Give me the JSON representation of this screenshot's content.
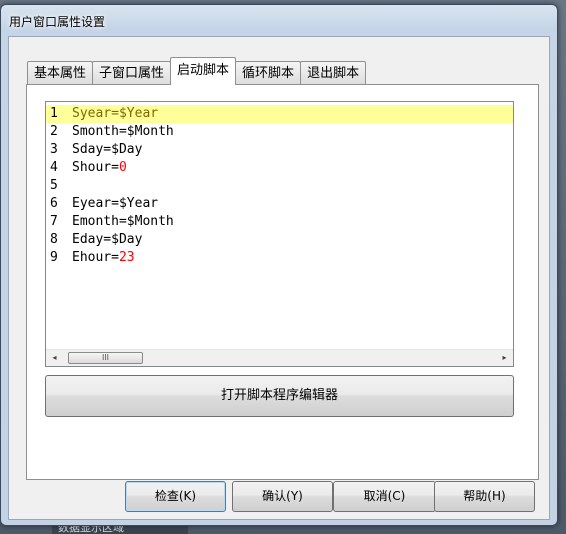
{
  "window": {
    "title": "用户窗口属性设置"
  },
  "tabs": [
    {
      "label": "基本属性",
      "active": false
    },
    {
      "label": "子窗口属性",
      "active": false
    },
    {
      "label": "启动脚本",
      "active": true
    },
    {
      "label": "循环脚本",
      "active": false
    },
    {
      "label": "退出脚本",
      "active": false
    }
  ],
  "editor": {
    "lines": [
      {
        "n": "1",
        "text": "Syear=$Year",
        "num": ""
      },
      {
        "n": "2",
        "text": "Smonth=$Month",
        "num": ""
      },
      {
        "n": "3",
        "text": "Sday=$Day",
        "num": ""
      },
      {
        "n": "4",
        "text": "Shour=",
        "num": "0"
      },
      {
        "n": "5",
        "text": "",
        "num": ""
      },
      {
        "n": "6",
        "text": "Eyear=$Year",
        "num": ""
      },
      {
        "n": "7",
        "text": "Emonth=$Month",
        "num": ""
      },
      {
        "n": "8",
        "text": "Eday=$Day",
        "num": ""
      },
      {
        "n": "9",
        "text": "Ehour=",
        "num": "23"
      }
    ],
    "scroll_left": "◂",
    "scroll_right": "▸",
    "scroll_grip": "III"
  },
  "buttons": {
    "open_editor": "打开脚本程序编辑器",
    "check": "检查(K)",
    "confirm": "确认(Y)",
    "cancel": "取消(C)",
    "help": "帮助(H)"
  },
  "background": {
    "label": "数据显示区域"
  },
  "colors": {
    "highlight": "#ffff99",
    "number": "#ff0000",
    "accent_border": "#3c7fb1"
  }
}
